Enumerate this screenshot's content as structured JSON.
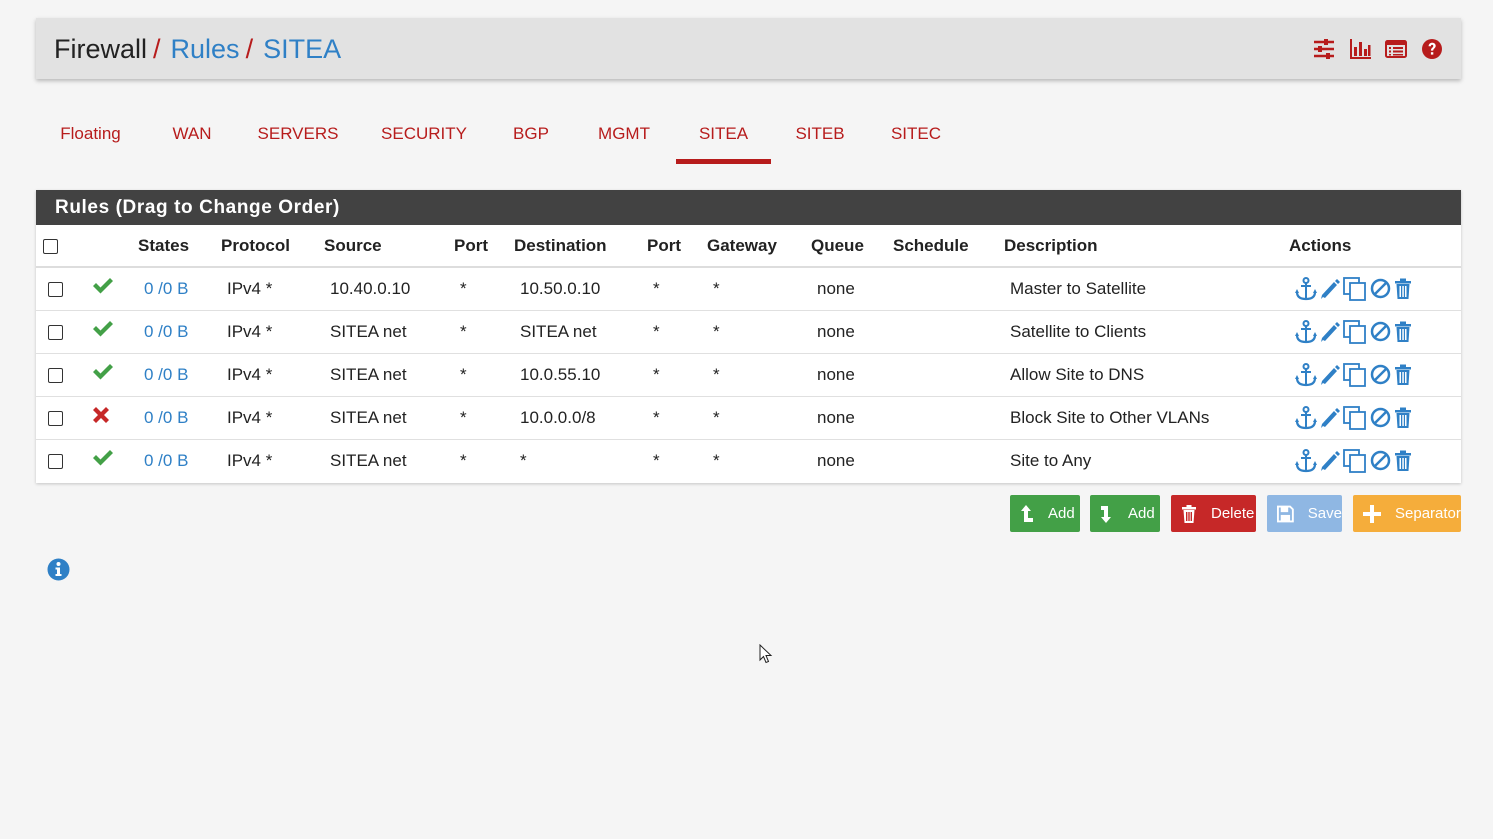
{
  "breadcrumb": {
    "root": "Firewall",
    "sep1": "/",
    "link1": "Rules",
    "sep2": "/",
    "link2": "SITEA"
  },
  "header_icons": [
    "sliders-icon",
    "bar-chart-icon",
    "list-table-icon",
    "help-circle-icon"
  ],
  "tabs": [
    {
      "label": "Floating",
      "active": false
    },
    {
      "label": "WAN",
      "active": false
    },
    {
      "label": "SERVERS",
      "active": false
    },
    {
      "label": "SECURITY",
      "active": false
    },
    {
      "label": "BGP",
      "active": false
    },
    {
      "label": "MGMT",
      "active": false
    },
    {
      "label": "SITEA",
      "active": true
    },
    {
      "label": "SITEB",
      "active": false
    },
    {
      "label": "SITEC",
      "active": false
    }
  ],
  "panel": {
    "title": "Rules (Drag to Change Order)"
  },
  "columns": [
    "States",
    "Protocol",
    "Source",
    "Port",
    "Destination",
    "Port",
    "Gateway",
    "Queue",
    "Schedule",
    "Description",
    "Actions"
  ],
  "rules": [
    {
      "status": "pass",
      "states": "0 /0 B",
      "protocol": "IPv4 *",
      "source": "10.40.0.10",
      "src_port": "*",
      "destination": "10.50.0.10",
      "dst_port": "*",
      "gateway": "*",
      "queue": "none",
      "schedule": "",
      "description": "Master to Satellite"
    },
    {
      "status": "pass",
      "states": "0 /0 B",
      "protocol": "IPv4 *",
      "source": "SITEA net",
      "src_port": "*",
      "destination": "SITEA net",
      "dst_port": "*",
      "gateway": "*",
      "queue": "none",
      "schedule": "",
      "description": "Satellite to Clients"
    },
    {
      "status": "pass",
      "states": "0 /0 B",
      "protocol": "IPv4 *",
      "source": "SITEA net",
      "src_port": "*",
      "destination": "10.0.55.10",
      "dst_port": "*",
      "gateway": "*",
      "queue": "none",
      "schedule": "",
      "description": "Allow Site to DNS"
    },
    {
      "status": "block",
      "states": "0 /0 B",
      "protocol": "IPv4 *",
      "source": "SITEA net",
      "src_port": "*",
      "destination": "10.0.0.0/8",
      "dst_port": "*",
      "gateway": "*",
      "queue": "none",
      "schedule": "",
      "description": "Block Site to Other VLANs"
    },
    {
      "status": "pass",
      "states": "0 /0 B",
      "protocol": "IPv4 *",
      "source": "SITEA net",
      "src_port": "*",
      "destination": "*",
      "dst_port": "*",
      "gateway": "*",
      "queue": "none",
      "schedule": "",
      "description": "Site to Any"
    }
  ],
  "row_action_icons": [
    "anchor-icon",
    "pencil-icon",
    "copy-icon",
    "disable-icon",
    "trash-icon"
  ],
  "buttons": {
    "add_top": "Add",
    "add_bottom": "Add",
    "delete": "Delete",
    "save": "Save",
    "separator": "Separator"
  },
  "colors": {
    "accent_red": "#b71c1c",
    "link_blue": "#2f80c6",
    "pass_green": "#43a047",
    "block_red": "#c62828",
    "panel_heading": "#424242",
    "button_orange": "#f5ad3b",
    "button_save": "#8fb7e3"
  }
}
